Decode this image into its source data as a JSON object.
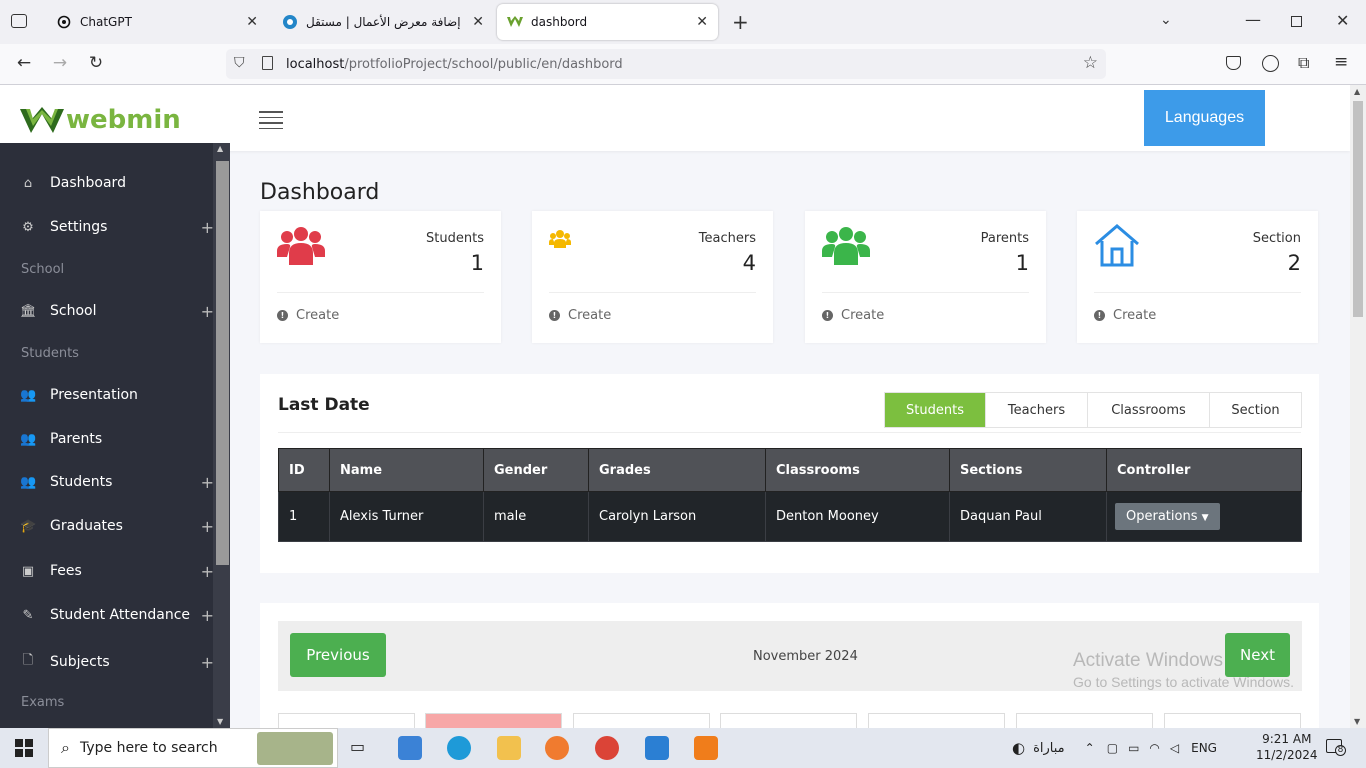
{
  "browser": {
    "tabs": [
      {
        "title": "ChatGPT",
        "active": false
      },
      {
        "title": "إضافة معرض الأعمال | مستقل",
        "active": false
      },
      {
        "title": "dashbord",
        "active": true
      }
    ],
    "new_tab": "+",
    "url_host": "localhost",
    "url_path": "/protfolioProject/school/public/en/dashbord"
  },
  "header": {
    "logo_text": "webmin",
    "languages_label": "Languages"
  },
  "sidebar": {
    "items": [
      {
        "label": "Dashboard",
        "icon": "home-icon",
        "plus": false
      },
      {
        "label": "Settings",
        "icon": "gear-icon",
        "plus": true
      },
      {
        "section": "School"
      },
      {
        "label": "School",
        "icon": "institution-icon",
        "plus": true
      },
      {
        "section": "Students"
      },
      {
        "label": "Presentation",
        "icon": "users-icon",
        "plus": false
      },
      {
        "label": "Parents",
        "icon": "users-icon",
        "plus": false
      },
      {
        "label": "Students",
        "icon": "users-icon",
        "plus": true
      },
      {
        "label": "Graduates",
        "icon": "graduation-cap-icon",
        "plus": true
      },
      {
        "label": "Fees",
        "icon": "money-icon",
        "plus": true
      },
      {
        "label": "Student Attendance",
        "icon": "edit-icon",
        "plus": true
      },
      {
        "label": "Subjects",
        "icon": "file-icon",
        "plus": true
      },
      {
        "section": "Exams"
      }
    ]
  },
  "main": {
    "page_title": "Dashboard",
    "cards": [
      {
        "label": "Students",
        "value": "1",
        "footer": "Create",
        "icon": "users-icon",
        "color": "#e03c4a"
      },
      {
        "label": "Teachers",
        "value": "4",
        "footer": "Create",
        "icon": "users-icon",
        "color": "#f5b800"
      },
      {
        "label": "Parents",
        "value": "1",
        "footer": "Create",
        "icon": "users-icon",
        "color": "#3bb54a"
      },
      {
        "label": "Section",
        "value": "2",
        "footer": "Create",
        "icon": "home-icon",
        "color": "#2b8de3"
      }
    ],
    "last_date": {
      "title": "Last Date",
      "tabs": [
        "Students",
        "Teachers",
        "Classrooms",
        "Section"
      ],
      "active_tab": "Students",
      "columns": [
        "ID",
        "Name",
        "Gender",
        "Grades",
        "Classrooms",
        "Sections",
        "Controller"
      ],
      "rows": [
        [
          "1",
          "Alexis Turner",
          "male",
          "Carolyn Larson",
          "Denton Mooney",
          "Daquan Paul",
          "Operations"
        ]
      ]
    },
    "calendar": {
      "prev_label": "Previous",
      "next_label": "Next",
      "month": "November 2024"
    }
  },
  "watermark": {
    "line1": "Activate Windows",
    "line2": "Go to Settings to activate Windows."
  },
  "taskbar": {
    "search_placeholder": "Type here to search",
    "weather": "مباراة",
    "lang": "ENG",
    "time": "9:21 AM",
    "date": "11/2/2024",
    "notifications": "8"
  },
  "colors": {
    "accent_green": "#7cbf3f",
    "languages_blue": "#3d9be9",
    "sidebar_bg": "#2c2f3a"
  }
}
